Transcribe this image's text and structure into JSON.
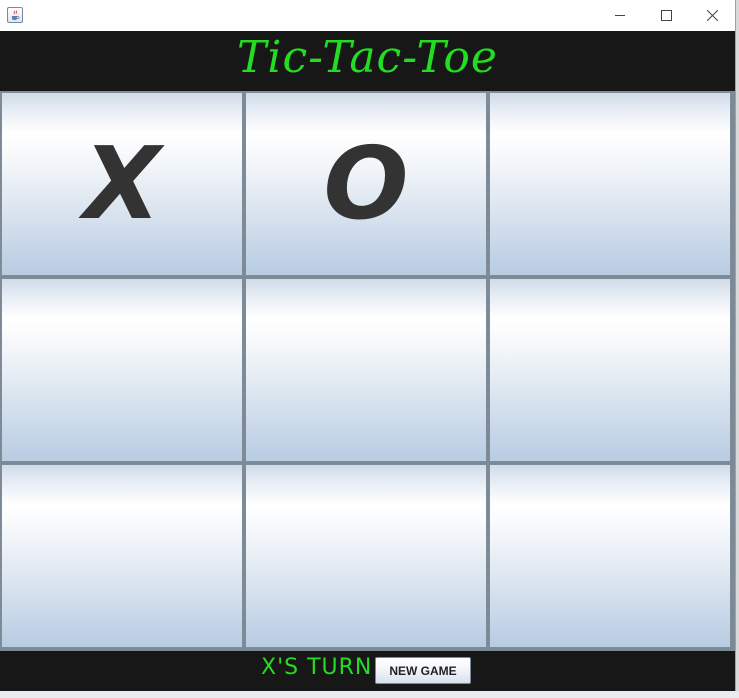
{
  "window": {
    "icon": "java-cup-icon",
    "controls": {
      "minimize": "minimize-icon",
      "maximize": "maximize-icon",
      "close": "close-icon"
    }
  },
  "header": {
    "title": "Tic-Tac-Toe"
  },
  "board": {
    "cells": [
      "X",
      "O",
      "",
      "",
      "",
      "",
      "",
      "",
      ""
    ]
  },
  "footer": {
    "turn_label": "X'S TURN",
    "new_game_label": "NEW GAME"
  },
  "colors": {
    "header_bg": "#171717",
    "accent_text": "#22dd22",
    "mark_color": "#333333",
    "cell_border": "#7f8c99"
  }
}
